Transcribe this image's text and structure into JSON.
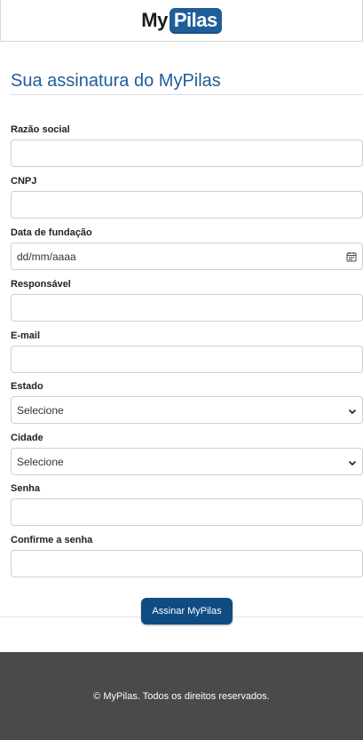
{
  "header": {
    "logo_part1": "My",
    "logo_part2": "Pilas",
    "brand_color": "#1f5e99"
  },
  "page": {
    "title": "Sua assinatura do MyPilas"
  },
  "form": {
    "fields": [
      {
        "label": "Razão social",
        "type": "text",
        "value": ""
      },
      {
        "label": "CNPJ",
        "type": "text",
        "value": ""
      },
      {
        "label": "Data de fundação",
        "type": "date",
        "value": "dd/mm/aaaa"
      },
      {
        "label": "Responsável",
        "type": "text",
        "value": ""
      },
      {
        "label": "E-mail",
        "type": "email",
        "value": ""
      },
      {
        "label": "Estado",
        "type": "select",
        "value": "Selecione"
      },
      {
        "label": "Cidade",
        "type": "select",
        "value": "Selecione"
      },
      {
        "label": "Senha",
        "type": "password",
        "value": ""
      },
      {
        "label": "Confirme a senha",
        "type": "password",
        "value": ""
      }
    ],
    "submit_label": "Assinar MyPilas",
    "submit_color": "#0f4c81"
  },
  "footer": {
    "text": "© MyPilas. Todos os direitos reservados.",
    "background": "#4a4a4a"
  }
}
